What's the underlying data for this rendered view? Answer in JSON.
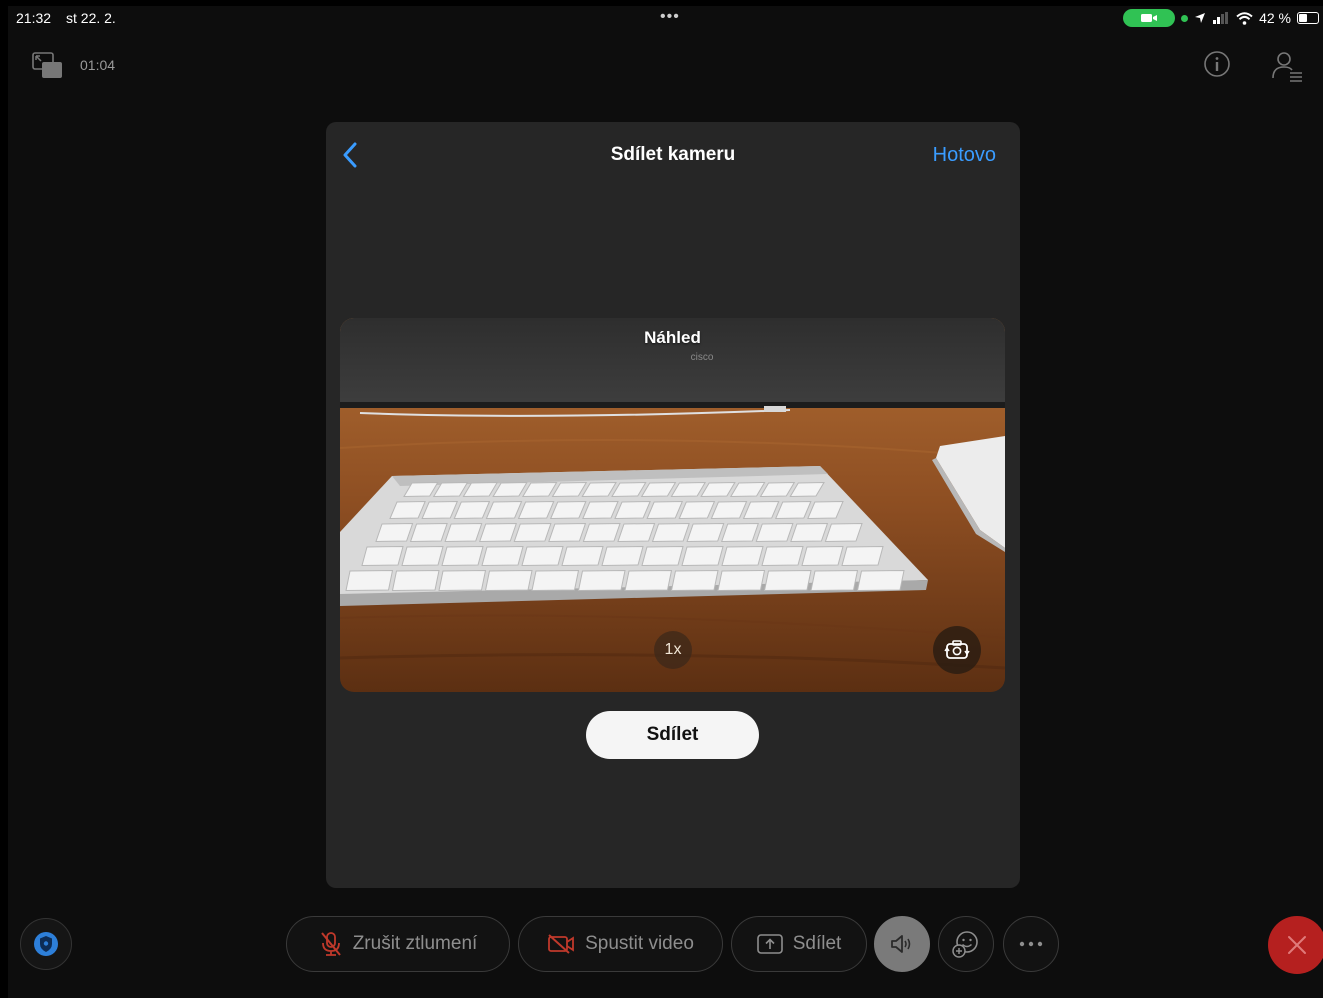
{
  "status_bar": {
    "time": "21:32",
    "date": "st 22. 2.",
    "battery": "42 %",
    "battery_level": 0.42,
    "multitask_dots": "•••"
  },
  "meeting": {
    "timer": "01:04"
  },
  "modal": {
    "title": "Sdílet kameru",
    "done_label": "Hotovo",
    "preview_label": "Náhled",
    "zoom_label": "1x",
    "share_label": "Sdílet"
  },
  "controls": {
    "unmute_label": "Zrušit ztlumení",
    "start_video_label": "Spustit video",
    "share_label": "Sdílet"
  },
  "colors": {
    "accent_blue": "#3a9cff",
    "end_call_red": "#b5201f",
    "status_green": "#30c254",
    "muted_red_icon": "#c0392b"
  }
}
